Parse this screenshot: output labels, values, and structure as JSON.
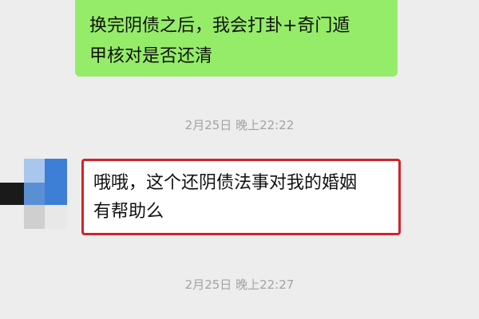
{
  "messages": [
    {
      "direction": "sent",
      "lines": [
        "换完阴债之后，我会打卦+奇门遁",
        "甲核对是否还清"
      ],
      "bubble_color": "#95ec69"
    },
    {
      "direction": "received",
      "lines": [
        "哦哦，这个还阴债法事对我的婚姻",
        "有帮助么"
      ],
      "bubble_color": "#ffffff",
      "highlight_border_color": "#d2232a"
    }
  ],
  "timestamps": [
    "2月25日 晚上22:22",
    "2月25日 晚上22:27"
  ],
  "avatar": {
    "icon": "mosaic-avatar-icon",
    "colors": [
      "#1a1a1a",
      "#3d7fd6",
      "#a9c6ec",
      "#cfcfcf",
      "#e8e8e8"
    ]
  }
}
